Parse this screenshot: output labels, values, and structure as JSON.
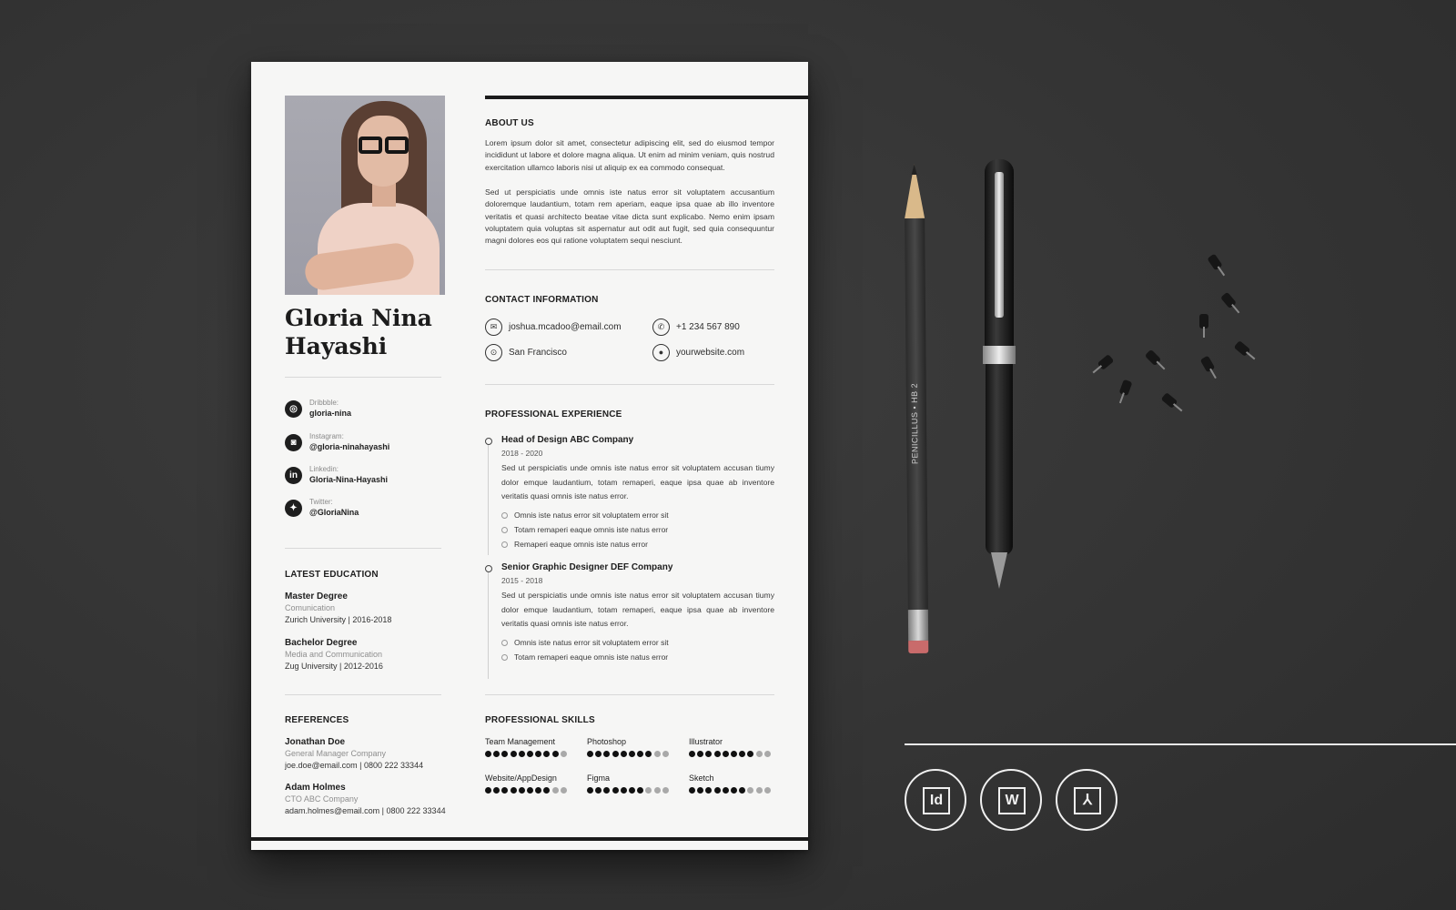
{
  "resume": {
    "name_line1": "Gloria Nina",
    "name_line2": "Hayashi",
    "social": [
      {
        "icon": "dribbble-icon",
        "glyph": "◎",
        "label": "Dribbble:",
        "value": "gloria-nina"
      },
      {
        "icon": "instagram-icon",
        "glyph": "◙",
        "label": "Instagram:",
        "value": "@gloria-ninahayashi"
      },
      {
        "icon": "linkedin-icon",
        "glyph": "in",
        "label": "Linkedin:",
        "value": "Gloria-Nina-Hayashi"
      },
      {
        "icon": "twitter-icon",
        "glyph": "✦",
        "label": "Twitter:",
        "value": "@GloriaNina"
      }
    ],
    "education": {
      "heading": "LATEST EDUCATION",
      "items": [
        {
          "degree": "Master Degree",
          "field": "Comunication",
          "school": "Zurich University | 2016-2018"
        },
        {
          "degree": "Bachelor Degree",
          "field": "Media and Communication",
          "school": "Zug University | 2012-2016"
        }
      ]
    },
    "references": {
      "heading": "REFERENCES",
      "items": [
        {
          "name": "Jonathan Doe",
          "role": "General Manager Company",
          "contact": "joe.doe@email.com | 0800 222 33344"
        },
        {
          "name": "Adam Holmes",
          "role": "CTO ABC Company",
          "contact": "adam.holmes@email.com | 0800 222 33344"
        }
      ]
    },
    "about": {
      "heading": "ABOUT US",
      "p1": "Lorem ipsum dolor sit amet, consectetur adipiscing elit, sed do eiusmod tempor incididunt ut labore et dolore magna aliqua. Ut enim ad minim veniam, quis nostrud exercitation ullamco laboris nisi ut aliquip ex ea commodo consequat.",
      "p2": "Sed ut perspiciatis unde omnis iste natus error sit voluptatem accusantium doloremque laudantium, totam rem aperiam, eaque ipsa quae ab illo inventore veritatis et quasi architecto beatae vitae dicta sunt explicabo. Nemo enim ipsam voluptatem quia voluptas sit aspernatur aut odit aut fugit, sed quia consequuntur magni dolores eos qui ratione voluptatem sequi nesciunt."
    },
    "contact": {
      "heading": "CONTACT INFORMATION",
      "email": "joshua.mcadoo@email.com",
      "phone": "+1 234 567  890",
      "location": "San Francisco",
      "website": "yourwebsite.com"
    },
    "experience": {
      "heading": "PROFESSIONAL EXPERIENCE",
      "jobs": [
        {
          "title": "Head of Design ABC Company",
          "years": "2018 - 2020",
          "desc": "Sed ut perspiciatis unde omnis iste natus error sit voluptatem accusan tiumy dolor emque laudantium, totam remaperi, eaque ipsa quae ab inventore veritatis quasi omnis iste natus error.",
          "bullets": [
            "Omnis iste natus error sit voluptatem error sit",
            "Totam remaperi eaque omnis iste natus error",
            "Remaperi eaque omnis iste natus error"
          ]
        },
        {
          "title": "Senior Graphic Designer DEF Company",
          "years": "2015 - 2018",
          "desc": "Sed ut perspiciatis unde omnis iste natus error sit voluptatem accusan tiumy dolor emque laudantium, totam remaperi, eaque ipsa quae ab inventore veritatis quasi omnis iste natus error.",
          "bullets": [
            "Omnis iste natus error sit voluptatem error sit",
            "Totam remaperi eaque omnis iste natus error"
          ]
        }
      ]
    },
    "skills": {
      "heading": "PROFESSIONAL SKILLS",
      "items": [
        {
          "name": "Team Management",
          "level": 9,
          "max": 10
        },
        {
          "name": "Photoshop",
          "level": 8,
          "max": 10
        },
        {
          "name": "Illustrator",
          "level": 8,
          "max": 10
        },
        {
          "name": "Website/AppDesign",
          "level": 8,
          "max": 10
        },
        {
          "name": "Figma",
          "level": 7,
          "max": 10
        },
        {
          "name": "Sketch",
          "level": 7,
          "max": 10
        }
      ]
    }
  },
  "desk": {
    "pencil_brand": "PENICILLUS  •  HB 2",
    "formats": [
      {
        "icon": "indesign-icon",
        "glyph": "Id"
      },
      {
        "icon": "word-icon",
        "glyph": "W"
      },
      {
        "icon": "pdf-icon",
        "glyph": "⅄"
      }
    ]
  },
  "colors": {
    "background": "#343434",
    "paper": "#f6f6f5",
    "ink": "#1e1e1e",
    "dot_off": "#a9a9a9"
  }
}
